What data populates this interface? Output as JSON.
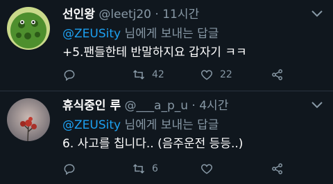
{
  "tweets": [
    {
      "name": "선인왕",
      "handle": "@leetj20",
      "dot": "·",
      "time": "11시간",
      "reply_mention": "@ZEUSity",
      "reply_suffix": " 님에게 보내는 답글",
      "text": "+5.팬들한테 반말하지요 갑자기 ㅋㅋ",
      "retweets": "42",
      "likes": "22",
      "icons": [
        "reply-icon",
        "retweet-icon",
        "like-icon",
        "share-icon",
        "chevron-down-icon"
      ]
    },
    {
      "name": "휴식중인 루",
      "handle": "@___a_p_u",
      "dot": "·",
      "time": "4시간",
      "reply_mention": "@ZEUSity",
      "reply_suffix": " 님에게 보내는 답글",
      "text": "6. 사고를 칩니다.. (음주운전 등등..)",
      "retweets": "6",
      "likes": "",
      "icons": [
        "reply-icon",
        "retweet-icon",
        "like-icon",
        "share-icon",
        "chevron-down-icon"
      ]
    }
  ],
  "colors": {
    "background": "#10171e",
    "accent": "#1da1f2",
    "muted": "#8899a6"
  }
}
